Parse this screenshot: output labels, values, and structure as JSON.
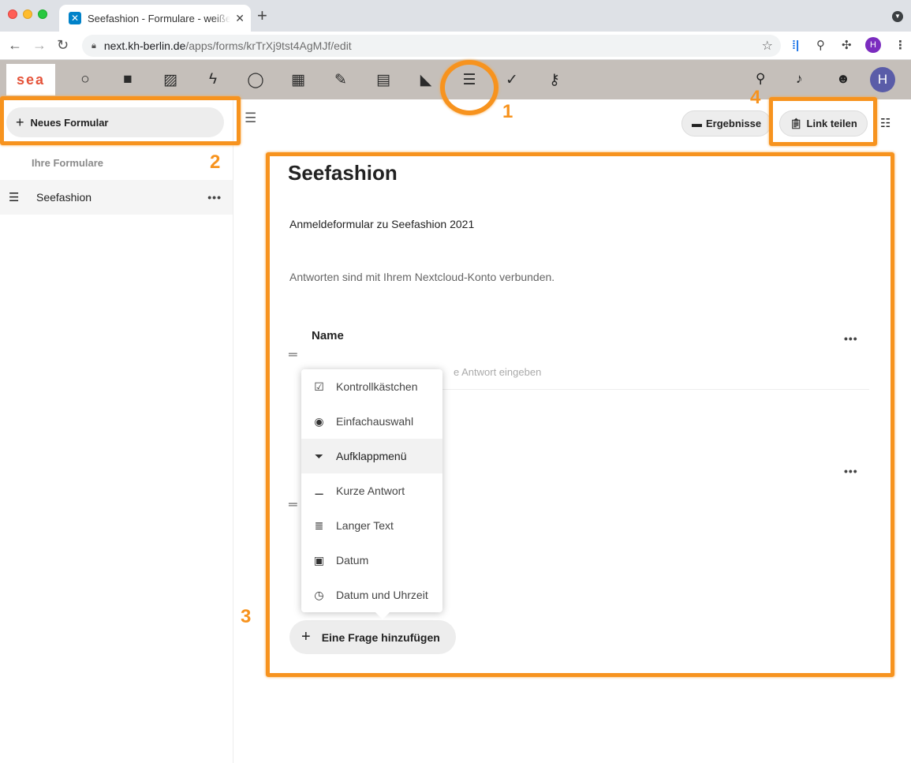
{
  "browser": {
    "tab_title": "Seefashion - Formulare - weißensee",
    "url_host": "next.kh-berlin.de",
    "url_path": "/apps/forms/krTrXj9tst4AgMJf/edit",
    "profile_initial": "H"
  },
  "header": {
    "logo": "sea",
    "user_initial": "H"
  },
  "sidebar": {
    "new_form_label": "Neues Formular",
    "caption": "Ihre Formulare",
    "forms": [
      {
        "label": "Seefashion"
      }
    ]
  },
  "toolbar": {
    "results_label": "Ergebnisse",
    "share_label": "Link teilen"
  },
  "form": {
    "title": "Seefashion",
    "description": "Anmeldeformular zu Seefashion 2021",
    "note": "Antworten sind mit Ihrem Nextcloud-Konto verbunden.",
    "questions": [
      {
        "title": "Name",
        "placeholder": "e Antwort eingeben"
      }
    ],
    "add_question_label": "Eine Frage hinzufügen"
  },
  "question_type_menu": {
    "items": [
      {
        "label": "Kontrollkästchen",
        "icon": "checkbox-icon"
      },
      {
        "label": "Einfachauswahl",
        "icon": "radio-icon"
      },
      {
        "label": "Aufklappmenü",
        "icon": "dropdown-icon",
        "highlighted": true
      },
      {
        "label": "Kurze Antwort",
        "icon": "short-text-icon"
      },
      {
        "label": "Langer Text",
        "icon": "long-text-icon"
      },
      {
        "label": "Datum",
        "icon": "calendar-icon"
      },
      {
        "label": "Datum und Uhrzeit",
        "icon": "clock-icon"
      }
    ]
  },
  "annotations": {
    "n1": "1",
    "n2": "2",
    "n3": "3",
    "n4": "4",
    "color": "#f7931e"
  }
}
